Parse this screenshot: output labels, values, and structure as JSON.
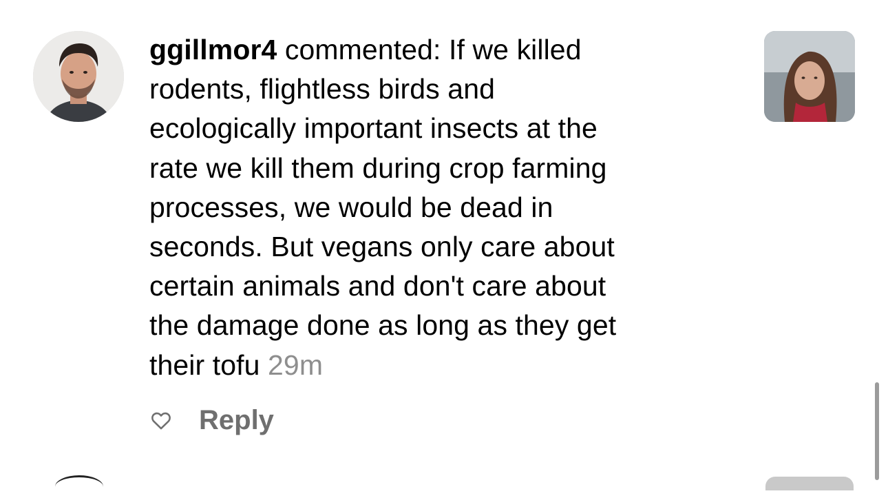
{
  "comment": {
    "username": "ggillmor4",
    "lines": [
      " commented: If we killed",
      "rodents, flightless birds and",
      "ecologically important insects at the",
      "rate we kill them during crop farming",
      "processes, we would be dead in",
      "seconds. But vegans only care about",
      "certain animals and don't care about",
      "the damage done as long as they get",
      "their tofu "
    ],
    "timestamp": "29m"
  },
  "actions": {
    "like_icon": "heart-outline-icon",
    "reply_label": "Reply"
  },
  "colors": {
    "text": "#000000",
    "timestamp": "#8e8e8e",
    "reply": "#6f6f6f",
    "scrollbar": "#9b9b9b"
  }
}
